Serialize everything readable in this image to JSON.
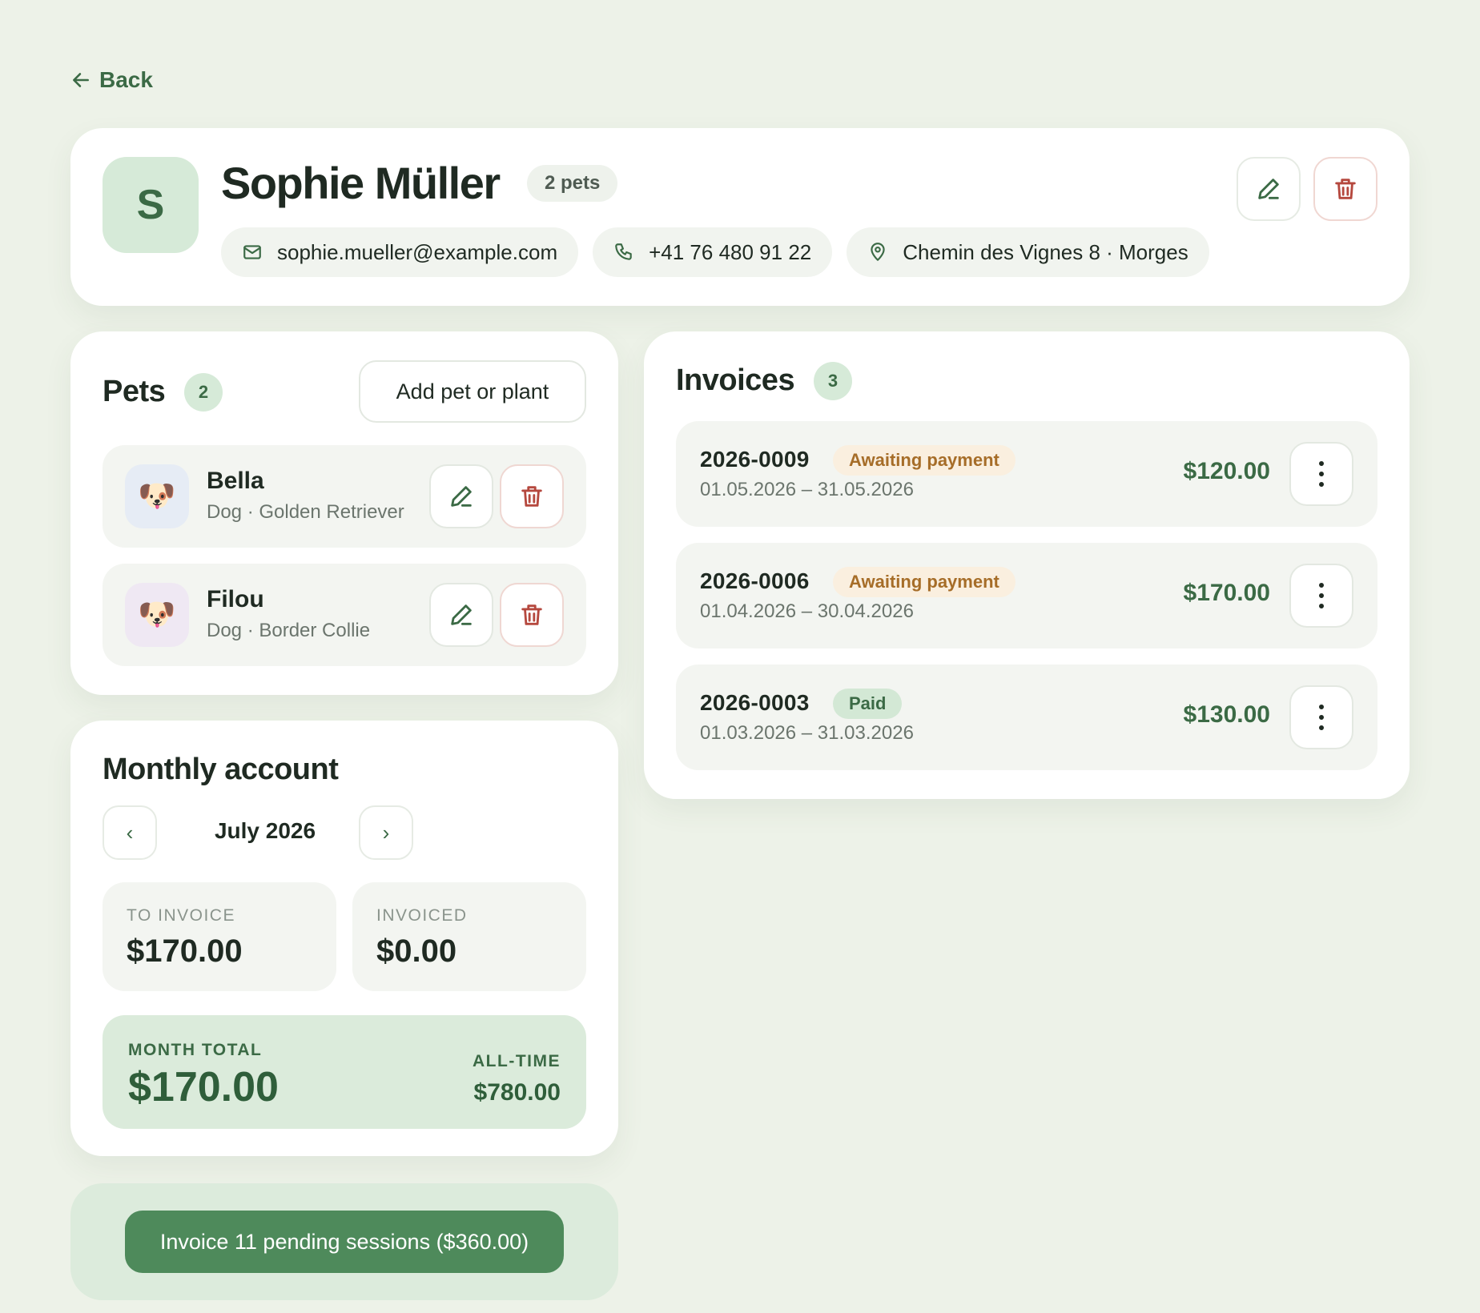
{
  "nav": {
    "back_label": "Back"
  },
  "client": {
    "initial": "S",
    "name": "Sophie Müller",
    "pets_chip": "2 pets",
    "email": "sophie.mueller@example.com",
    "phone": "+41 76 480 91 22",
    "address": "Chemin des Vignes 8 · Morges"
  },
  "pets": {
    "title": "Pets",
    "count": "2",
    "add_label": "Add pet or plant",
    "items": [
      {
        "name": "Bella",
        "detail": "Dog · Golden Retriever",
        "emoji": "🐶",
        "tile_color": "#e6ecf5"
      },
      {
        "name": "Filou",
        "detail": "Dog · Border Collie",
        "emoji": "🐶",
        "tile_color": "#efe8f3"
      }
    ]
  },
  "monthly": {
    "title": "Monthly account",
    "prev": "‹",
    "next": "›",
    "month": "July 2026",
    "to_invoice_label": "TO INVOICE",
    "to_invoice_value": "$170.00",
    "invoiced_label": "INVOICED",
    "invoiced_value": "$0.00",
    "month_total_label": "MONTH TOTAL",
    "month_total_value": "$170.00",
    "alltime_label": "ALL-TIME",
    "alltime_value": "$780.00"
  },
  "pending": {
    "button_label": "Invoice 11 pending sessions ($360.00)"
  },
  "invoices": {
    "title": "Invoices",
    "count": "3",
    "items": [
      {
        "number": "2026-0009",
        "status": "Awaiting payment",
        "status_kind": "awaiting",
        "period": "01.05.2026 – 31.05.2026",
        "amount": "$120.00"
      },
      {
        "number": "2026-0006",
        "status": "Awaiting payment",
        "status_kind": "awaiting",
        "period": "01.04.2026 – 30.04.2026",
        "amount": "$170.00"
      },
      {
        "number": "2026-0003",
        "status": "Paid",
        "status_kind": "paid",
        "period": "01.03.2026 – 31.03.2026",
        "amount": "$130.00"
      }
    ]
  },
  "colors": {
    "background": "#edf2e8",
    "accent": "#3b6a45",
    "primary_button": "#4e8a5b",
    "danger": "#b5483e",
    "awaiting": "#a66d28"
  }
}
